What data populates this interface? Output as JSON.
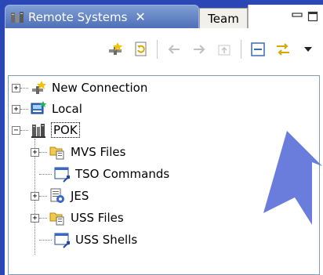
{
  "tabs": {
    "active_label": "Remote Systems",
    "close_glyph": "✕",
    "inactive_label": "Team"
  },
  "view_controls": {
    "minimize_glyph": "▭",
    "maximize_glyph": "□"
  },
  "tree": {
    "items": [
      {
        "label": "New Connection",
        "expander": "+"
      },
      {
        "label": "Local",
        "expander": "+"
      },
      {
        "label": "POK",
        "expander": "−"
      },
      {
        "label": "MVS Files",
        "expander": "+"
      },
      {
        "label": "TSO Commands",
        "expander": ""
      },
      {
        "label": "JES",
        "expander": "+"
      },
      {
        "label": "USS Files",
        "expander": "+"
      },
      {
        "label": "USS Shells",
        "expander": ""
      }
    ]
  },
  "colors": {
    "background": "#2b46b5",
    "tab_active": "#5f80c4",
    "arrow": "#5a6fd8"
  }
}
